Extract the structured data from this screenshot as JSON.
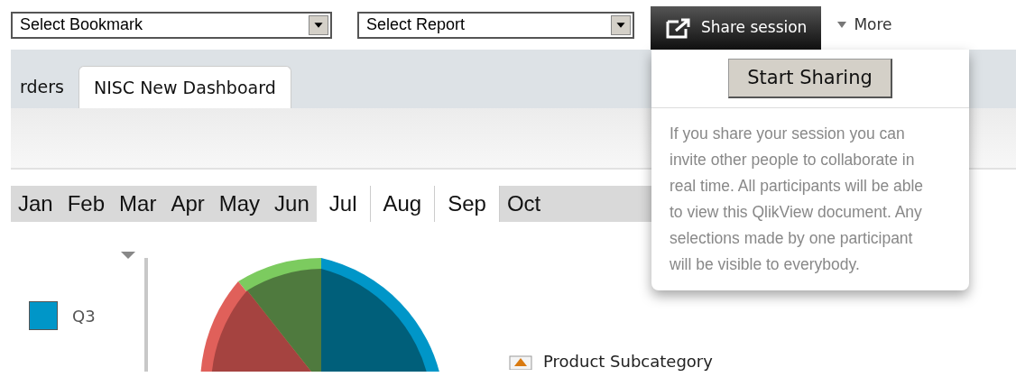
{
  "toolbar": {
    "bookmark_select": {
      "value": "Select Bookmark"
    },
    "report_select": {
      "value": "Select Report"
    },
    "share_button": {
      "label": "Share session",
      "selected": true
    },
    "more_menu": {
      "label": "More"
    }
  },
  "sheet_tabs": [
    {
      "label": "rders",
      "selected": false
    },
    {
      "label": "NISC New Dashboard",
      "selected": true
    }
  ],
  "months": [
    {
      "label": "Jan",
      "selected": false
    },
    {
      "label": "Feb",
      "selected": false
    },
    {
      "label": "Mar",
      "selected": false
    },
    {
      "label": "Apr",
      "selected": false
    },
    {
      "label": "May",
      "selected": false
    },
    {
      "label": "Jun",
      "selected": false
    },
    {
      "label": "Jul",
      "selected": true
    },
    {
      "label": "Aug",
      "selected": true
    },
    {
      "label": "Sep",
      "selected": true
    },
    {
      "label": "Oct",
      "selected": false
    }
  ],
  "legend": [
    {
      "label": "Q3",
      "color": "#0096c8"
    }
  ],
  "dimension_label": "Product Subcategory",
  "share_popup": {
    "button": "Start Sharing",
    "message": "If you share your session you can invite other people to collaborate in real time. All participants will be able to view this QlikView document. Any selections made by one participant will be visible to everybody."
  }
}
